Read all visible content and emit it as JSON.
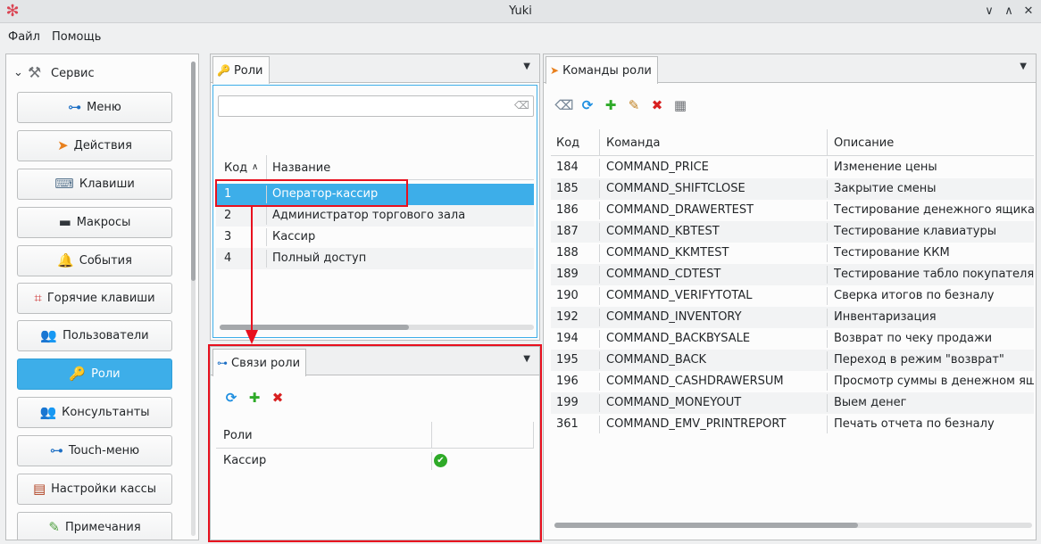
{
  "window": {
    "title": "Yuki"
  },
  "menubar": {
    "file": "Файл",
    "help": "Помощь"
  },
  "sidebar": {
    "group_label": "Сервис",
    "items": [
      {
        "label": "Меню",
        "icon": "⊶",
        "color": "#1d6fc4"
      },
      {
        "label": "Действия",
        "icon": "➤",
        "color": "#e8801e"
      },
      {
        "label": "Клавиши",
        "icon": "⌨",
        "color": "#5c7891"
      },
      {
        "label": "Макросы",
        "icon": "▬",
        "color": "#31363b"
      },
      {
        "label": "События",
        "icon": "🔔",
        "color": "#e0b400"
      },
      {
        "label": "Горячие клавиши",
        "icon": "⌗",
        "color": "#d04040"
      },
      {
        "label": "Пользователи",
        "icon": "👥",
        "color": "#c06030"
      },
      {
        "label": "Роли",
        "icon": "🔑",
        "color": "#f0c000"
      },
      {
        "label": "Консультанты",
        "icon": "👥",
        "color": "#3070c0"
      },
      {
        "label": "Touch-меню",
        "icon": "⊶",
        "color": "#1d6fc4"
      },
      {
        "label": "Настройки кассы",
        "icon": "▤",
        "color": "#b04020"
      },
      {
        "label": "Примечания",
        "icon": "✎",
        "color": "#50a040"
      }
    ],
    "active_index": 7
  },
  "roles_panel": {
    "tab_label": "Роли",
    "columns": [
      "Код",
      "Название"
    ],
    "rows": [
      {
        "code": "1",
        "name": "Оператор-кассир"
      },
      {
        "code": "2",
        "name": "Администратор торгового зала"
      },
      {
        "code": "3",
        "name": "Кассир"
      },
      {
        "code": "4",
        "name": "Полный доступ"
      }
    ],
    "selected_index": 0
  },
  "links_panel": {
    "tab_label": "Связи роли",
    "columns": [
      "Роли",
      ""
    ],
    "rows": [
      {
        "role": "Кассир",
        "status": "enabled"
      }
    ]
  },
  "commands_panel": {
    "tab_label": "Команды роли",
    "columns": [
      "Код",
      "Команда",
      "Описание"
    ],
    "rows": [
      {
        "code": "184",
        "command": "COMMAND_PRICE",
        "desc": "Изменение цены"
      },
      {
        "code": "185",
        "command": "COMMAND_SHIFTCLOSE",
        "desc": "Закрытие смены"
      },
      {
        "code": "186",
        "command": "COMMAND_DRAWERTEST",
        "desc": "Тестирование денежного ящика"
      },
      {
        "code": "187",
        "command": "COMMAND_KBTEST",
        "desc": "Тестирование клавиатуры"
      },
      {
        "code": "188",
        "command": "COMMAND_KKMTEST",
        "desc": "Тестирование ККМ"
      },
      {
        "code": "189",
        "command": "COMMAND_CDTEST",
        "desc": "Тестирование табло покупателя"
      },
      {
        "code": "190",
        "command": "COMMAND_VERIFYTOTAL",
        "desc": "Сверка итогов по безналу"
      },
      {
        "code": "192",
        "command": "COMMAND_INVENTORY",
        "desc": "Инвентаризация"
      },
      {
        "code": "194",
        "command": "COMMAND_BACKBYSALE",
        "desc": "Возврат по чеку продажи"
      },
      {
        "code": "195",
        "command": "COMMAND_BACK",
        "desc": "Переход в режим \"возврат\""
      },
      {
        "code": "196",
        "command": "COMMAND_CASHDRAWERSUM",
        "desc": "Просмотр суммы в денежном ящике"
      },
      {
        "code": "199",
        "command": "COMMAND_MONEYOUT",
        "desc": "Выем денег"
      },
      {
        "code": "361",
        "command": "COMMAND_EMV_PRINTREPORT",
        "desc": "Печать отчета по безналу"
      }
    ]
  },
  "colors": {
    "accent": "#3daee9",
    "annotation_red": "#e8101e"
  }
}
